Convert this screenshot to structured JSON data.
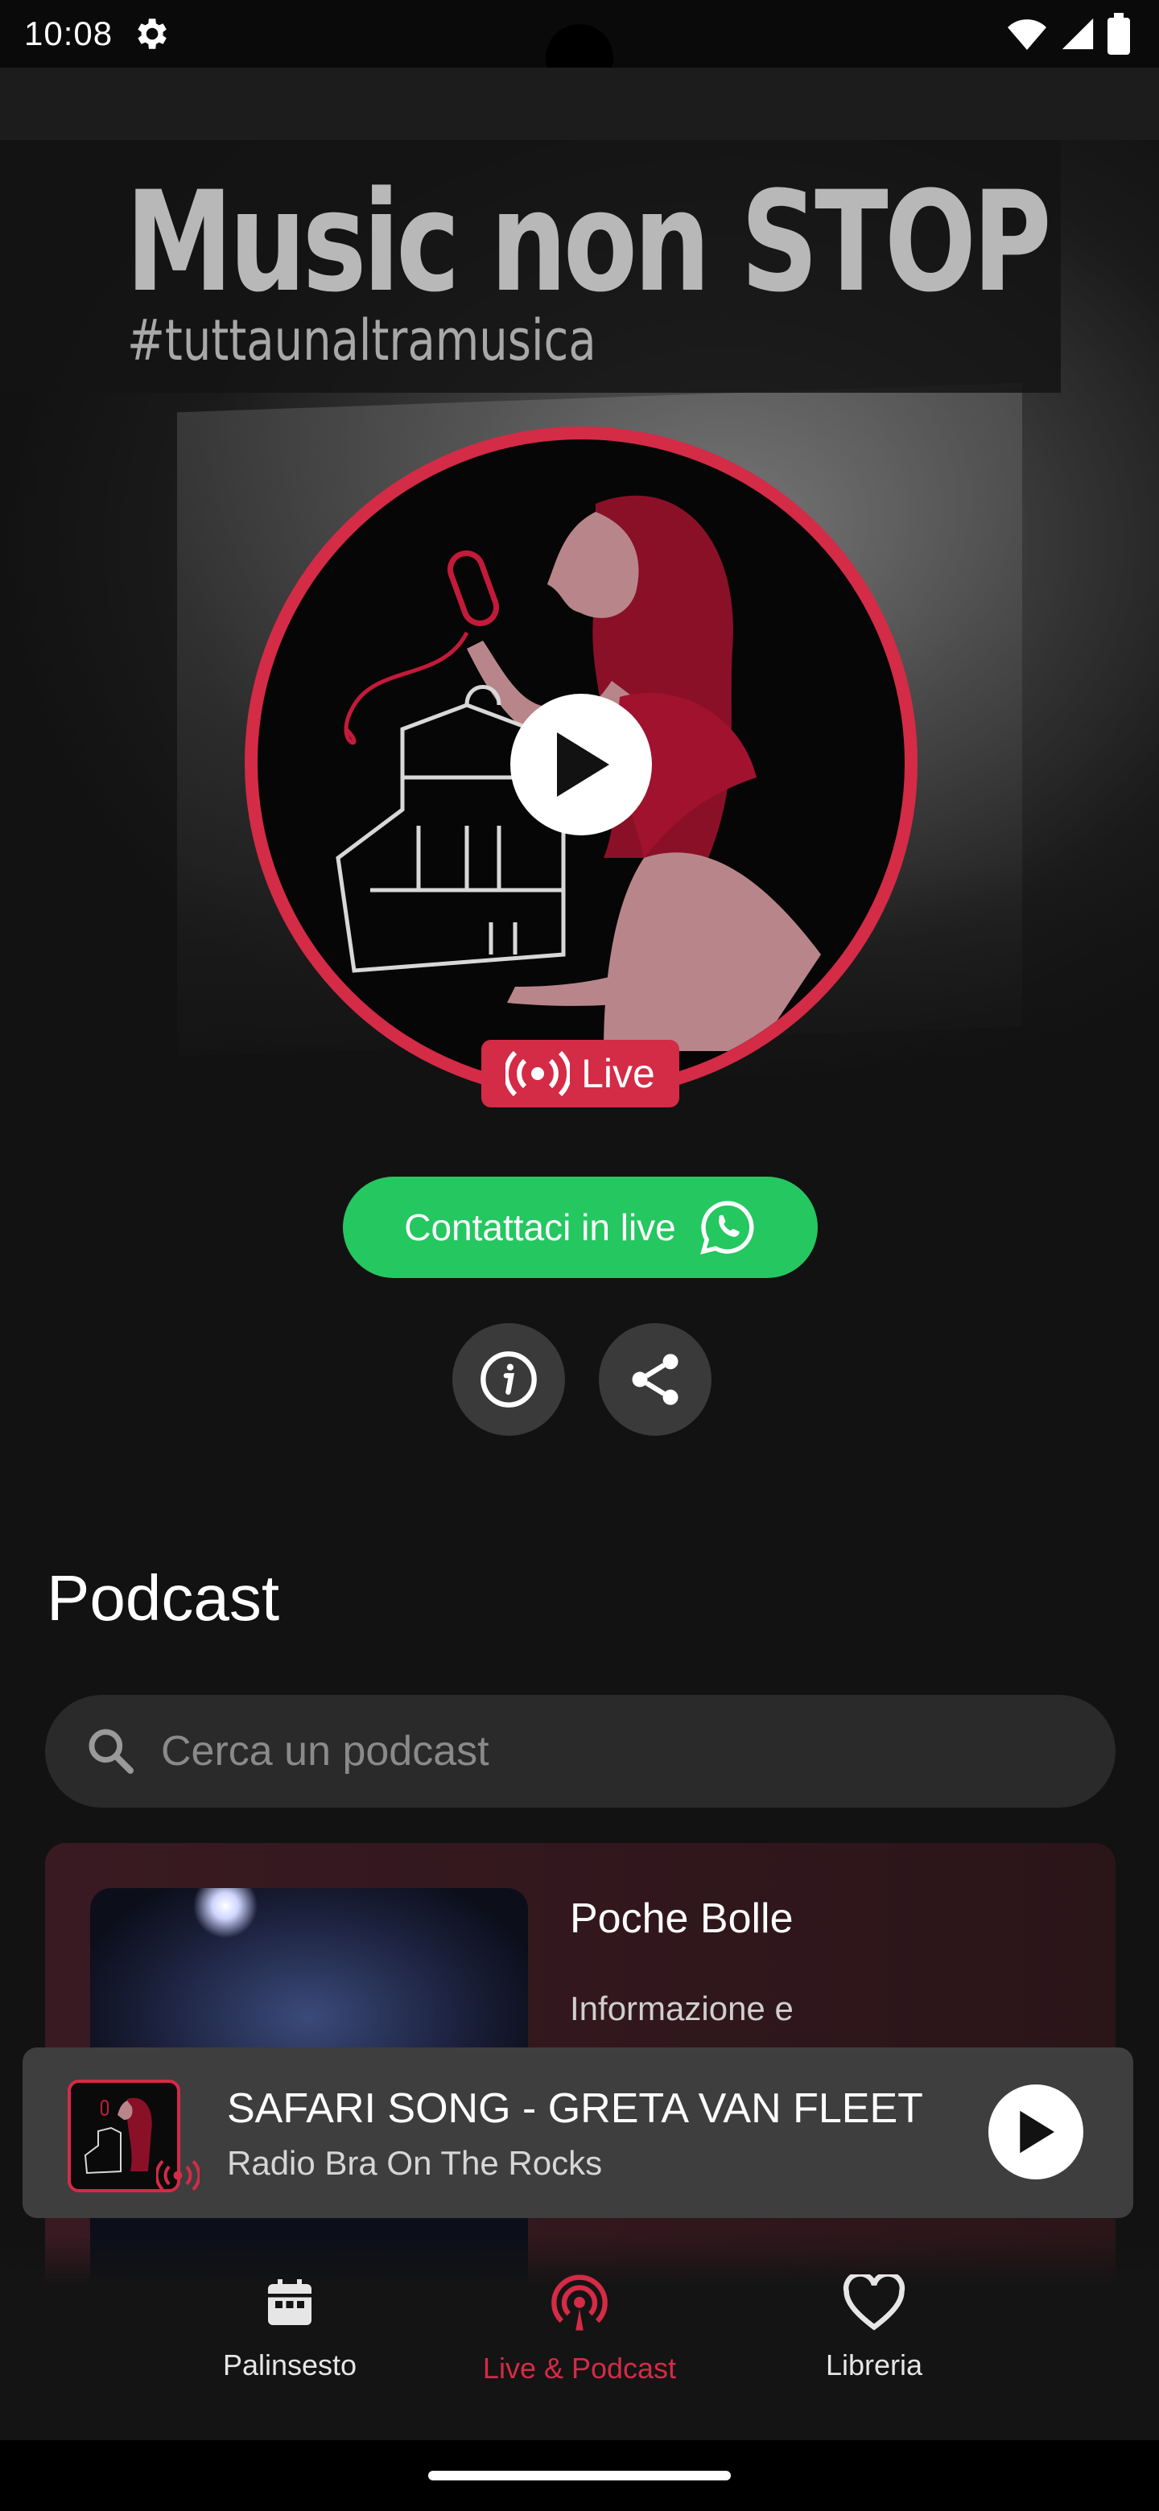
{
  "status_bar": {
    "time": "10:08"
  },
  "hero": {
    "banner_title": "Music non STOP",
    "banner_subtitle": "#tuttaunaltramusica",
    "live_label": "Live",
    "contact_label": "Contattaci in live"
  },
  "podcast_section": {
    "title": "Podcast",
    "search_placeholder": "Cerca un podcast",
    "card": {
      "name": "Poche Bolle",
      "description": "Informazione e"
    }
  },
  "mini_player": {
    "title": "SAFARI SONG - GRETA VAN FLEET",
    "subtitle": "Radio Bra On The Rocks"
  },
  "bottom_nav": {
    "items": [
      {
        "label": "Palinsesto",
        "icon": "calendar-icon",
        "active": false
      },
      {
        "label": "Live & Podcast",
        "icon": "podcast-icon",
        "active": true
      },
      {
        "label": "Libreria",
        "icon": "heart-icon",
        "active": false
      }
    ]
  },
  "colors": {
    "accent": "#d42b46",
    "whatsapp": "#25c760",
    "background": "#121212"
  }
}
